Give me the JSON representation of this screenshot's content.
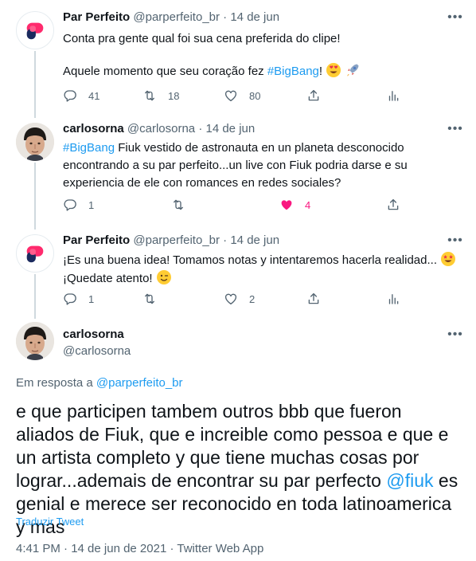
{
  "tweets": [
    {
      "name": "Par Perfeito",
      "handle": "@parperfeito_br",
      "separator": "·",
      "date": "14 de jun",
      "line1": "Conta pra gente qual foi sua cena preferida do clipe!",
      "line2_prefix": "Aquele momento que seu coração fez ",
      "hashtag": "#BigBang",
      "line2_suffix": "!",
      "emojis": [
        "heart-eyes-emoji",
        "rocket-emoji"
      ],
      "replies": "41",
      "retweets": "18",
      "likes": "80"
    },
    {
      "name": "carlosorna",
      "handle": "@carlosorna",
      "separator": "·",
      "date": "14 de jun",
      "hashtag": "#BigBang",
      "text_rest": " Fiuk vestido de astronauta en un planeta desconocido encontrando a su par perfeito...un live con Fiuk podria darse e su experiencia de ele con romances en redes sociales?",
      "replies": "1",
      "retweets": "",
      "likes": "4",
      "liked": true
    },
    {
      "name": "Par Perfeito",
      "handle": "@parperfeito_br",
      "separator": "·",
      "date": "14 de jun",
      "line1": "¡Es una buena idea! Tomamos notas y intentaremos hacerla realidad...",
      "line2": "¡Quedate atento!",
      "emojis": [
        "star-struck-emoji",
        "winking-emoji"
      ],
      "replies": "1",
      "retweets": "",
      "likes": "2"
    }
  ],
  "main": {
    "name": "carlosorna",
    "handle": "@carlosorna",
    "reply_prefix": "Em resposta a ",
    "reply_handle": "@parperfeito_br",
    "text_before": "e que participen tambem outros bbb que fueron aliados de Fiuk, que e increible como pessoa e que e un artista completo y que tiene muchas cosas por lograr...ademais de encontrar su par perfecto ",
    "mention": "@fiuk",
    "text_after": " es genial e merece ser reconocido en toda latinoamerica y mas",
    "translate": "Traduzir Tweet",
    "meta": "4:41 PM · 14 de jun de 2021 · Twitter Web App"
  },
  "colors": {
    "accent": "#1d9bf0",
    "like": "#f91880",
    "muted": "#536471",
    "brand_pink": "#ff2a6d",
    "brand_navy": "#1b2a5e"
  },
  "icons": {
    "reply": "reply-icon",
    "retweet": "retweet-icon",
    "like": "heart-icon",
    "share": "share-icon",
    "analytics": "analytics-icon",
    "more": "more-icon"
  }
}
